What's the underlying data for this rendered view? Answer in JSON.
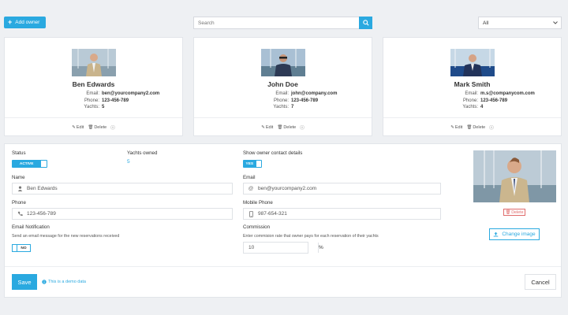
{
  "toolbar": {
    "add_owner_label": "Add owner",
    "search_placeholder": "Search",
    "filter_selected": "All"
  },
  "owners": [
    {
      "name": "Ben Edwards",
      "email_label": "Email:",
      "email": "ben@yourcompany2.com",
      "phone_label": "Phone:",
      "phone": "123-456-789",
      "yachts_label": "Yachts:",
      "yachts": "5",
      "edit": "Edit",
      "delete": "Delete"
    },
    {
      "name": "John Doe",
      "email_label": "Email:",
      "email": "john@company.com",
      "phone_label": "Phone:",
      "phone": "123-456-789",
      "yachts_label": "Yachts:",
      "yachts": "7",
      "edit": "Edit",
      "delete": "Delete"
    },
    {
      "name": "Mark Smith",
      "email_label": "Email:",
      "email": "m.s@companycom.com",
      "phone_label": "Phone:",
      "phone": "123-456-789",
      "yachts_label": "Yachts:",
      "yachts": "4",
      "edit": "Edit",
      "delete": "Delete"
    }
  ],
  "form": {
    "status_label": "Status",
    "status_value": "ACTIVE",
    "yachts_owned_label": "Yachts owned",
    "yachts_owned_value": "5",
    "show_contact_label": "Show owner contact details",
    "show_contact_value": "YES",
    "name_label": "Name",
    "name_value": "Ben Edwards",
    "email_label": "Email",
    "email_value": "ben@yourcompany2.com",
    "phone_label": "Phone",
    "phone_value": "123-456-789",
    "mobile_label": "Mobile Phone",
    "mobile_value": "987-654-321",
    "email_notif_label": "Email Notification",
    "email_notif_hint": "Send an email message for the new reservations received",
    "email_notif_value": "NO",
    "commission_label": "Commission",
    "commission_hint": "Enter commision rate that owner pays for each reservation of their yachts",
    "commission_value": "10",
    "commission_suffix": "%",
    "delete_photo_label": "Delete",
    "change_image_label": "Change image",
    "save_label": "Save",
    "demo_note": "This is a demo data",
    "cancel_label": "Cancel"
  },
  "colors": {
    "accent": "#2aa9e0",
    "danger": "#e06c6c",
    "background": "#eef0f3"
  }
}
